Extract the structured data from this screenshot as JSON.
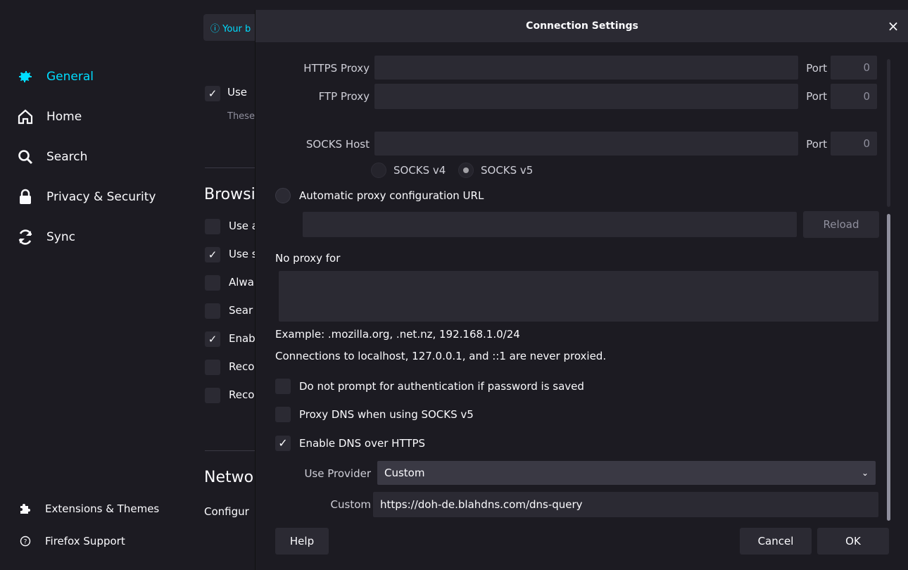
{
  "sidebar": {
    "items": [
      {
        "label": "General",
        "icon": "gear-icon",
        "active": true
      },
      {
        "label": "Home",
        "icon": "home-icon"
      },
      {
        "label": "Search",
        "icon": "search-icon"
      },
      {
        "label": "Privacy & Security",
        "icon": "lock-icon"
      },
      {
        "label": "Sync",
        "icon": "sync-icon"
      }
    ],
    "bottom": [
      {
        "label": "Extensions & Themes",
        "icon": "puzzle-icon"
      },
      {
        "label": "Firefox Support",
        "icon": "help-icon"
      }
    ]
  },
  "background": {
    "banner": "ⓘ Your b",
    "rows": [
      {
        "label": "Use",
        "checked": true
      },
      {
        "label": "These",
        "muted": true
      }
    ],
    "heading_browsing": "Browsi",
    "browsing_rows": [
      {
        "label": "Use a",
        "checked": false
      },
      {
        "label": "Use s",
        "checked": true
      },
      {
        "label": "Alwa",
        "checked": false
      },
      {
        "label": "Sear",
        "checked": false
      },
      {
        "label": "Enab",
        "checked": true
      },
      {
        "label": "Reco",
        "checked": false
      },
      {
        "label": "Reco",
        "checked": false
      }
    ],
    "heading_network": "Netwo",
    "network_text": "Configur"
  },
  "dialog": {
    "title": "Connection Settings",
    "close": "×",
    "https_proxy_label": "HTTPS Proxy",
    "ftp_proxy_label": "FTP Proxy",
    "socks_host_label": "SOCKS Host",
    "port_label": "Port",
    "https_port": "0",
    "ftp_port": "0",
    "socks_port": "0",
    "socks_v4": "SOCKS v4",
    "socks_v5": "SOCKS v5",
    "auto_proxy_label": "Automatic proxy configuration URL",
    "reload": "Reload",
    "no_proxy_label": "No proxy for",
    "example": "Example: .mozilla.org, .net.nz, 192.168.1.0/24",
    "localhost_note": "Connections to localhost, 127.0.0.1, and ::1 are never proxied.",
    "no_prompt_auth": "Do not prompt for authentication if password is saved",
    "no_prompt_auth_checked": false,
    "proxy_dns": "Proxy DNS when using SOCKS v5",
    "proxy_dns_checked": false,
    "enable_doh": "Enable DNS over HTTPS",
    "enable_doh_checked": true,
    "use_provider_label": "Use Provider",
    "provider_value": "Custom",
    "custom_label": "Custom",
    "custom_value": "https://doh-de.blahdns.com/dns-query",
    "help": "Help",
    "cancel": "Cancel",
    "ok": "OK"
  }
}
